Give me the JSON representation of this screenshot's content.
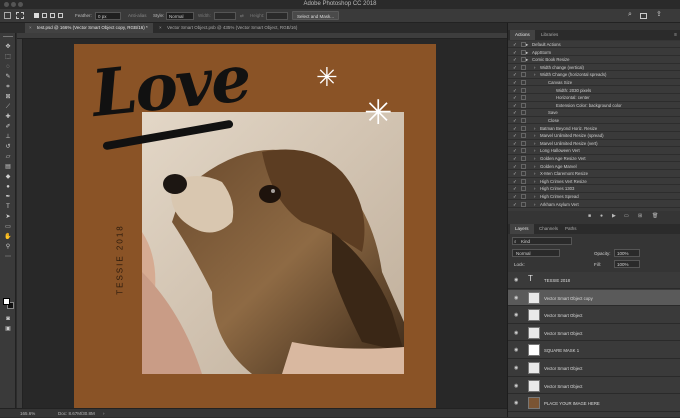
{
  "window": {
    "title": "Adobe Photoshop CC 2018"
  },
  "options_bar": {
    "feather_label": "Feather:",
    "feather_value": "0 px",
    "antialias_label": "Anti-alias",
    "style_label": "Style:",
    "style_value": "Normal",
    "width_label": "Width:",
    "height_label": "Height:",
    "select_mask_label": "Select and Mask..."
  },
  "tabs": [
    {
      "label": "test.psd @ 166% (Vector Smart Object copy, RGB/16) *"
    },
    {
      "label": "Vector Smart Object.psb @ 435% (Vector Smart Object, RGB/16)"
    }
  ],
  "artwork": {
    "love_text": "Love",
    "side_text": "TESSIE 2018"
  },
  "status": {
    "zoom": "165.6%",
    "doc": "Doc: 8.67M/30.8M"
  },
  "actions_panel": {
    "tabs": [
      "Actions",
      "Libraries"
    ],
    "rows": [
      {
        "label": "Default Actions",
        "kind": "folder",
        "indent": 0
      },
      {
        "label": "AppStorm",
        "kind": "folder",
        "indent": 0
      },
      {
        "label": "Comic Book Resize",
        "kind": "folder",
        "indent": 0
      },
      {
        "label": "Width change (vertical)",
        "kind": "action",
        "indent": 1
      },
      {
        "label": "Width Change (horizontal spreads)",
        "kind": "action",
        "indent": 1
      },
      {
        "label": "Canvas Size",
        "kind": "step",
        "indent": 2
      },
      {
        "label": "Width: 2030 pixels",
        "kind": "detail",
        "indent": 3
      },
      {
        "label": "Horizontal: center",
        "kind": "detail",
        "indent": 3
      },
      {
        "label": "Extension Color: background color",
        "kind": "detail",
        "indent": 3
      },
      {
        "label": "Save",
        "kind": "step",
        "indent": 2
      },
      {
        "label": "Close",
        "kind": "step",
        "indent": 2
      },
      {
        "label": "Batman Beyond Horiz. Resize",
        "kind": "action",
        "indent": 1
      },
      {
        "label": "Marvel Unlimited Resize (spread)",
        "kind": "action",
        "indent": 1
      },
      {
        "label": "Marvel Unlimited Resize (vert)",
        "kind": "action",
        "indent": 1
      },
      {
        "label": "Long Halloween Vert",
        "kind": "action",
        "indent": 1
      },
      {
        "label": "Golden Age Resize Vert",
        "kind": "action",
        "indent": 1
      },
      {
        "label": "Golden Age Marvel",
        "kind": "action",
        "indent": 1
      },
      {
        "label": "X-Men Claremont Resize",
        "kind": "action",
        "indent": 1
      },
      {
        "label": "High Crimes Vert Resize",
        "kind": "action",
        "indent": 1
      },
      {
        "label": "High Crimes 1303",
        "kind": "action",
        "indent": 1
      },
      {
        "label": "High Crimes Spread",
        "kind": "action",
        "indent": 1
      },
      {
        "label": "Arkham Asylum Vert",
        "kind": "action",
        "indent": 1
      }
    ]
  },
  "layers_panel": {
    "tabs": [
      "Layers",
      "Channels",
      "Paths"
    ],
    "kind_label": "Kind",
    "blend_mode": "Normal",
    "opacity_label": "Opacity:",
    "opacity_value": "100%",
    "lock_label": "Lock:",
    "fill_label": "Fill:",
    "fill_value": "100%",
    "layers": [
      {
        "name": "TESSIE 2018",
        "type": "text",
        "selected": false
      },
      {
        "name": "Vector Smart Object copy",
        "type": "smart",
        "selected": true
      },
      {
        "name": "Vector Smart Object",
        "type": "smart",
        "selected": false
      },
      {
        "name": "Vector Smart Object",
        "type": "smart",
        "selected": false
      },
      {
        "name": "SQUARE MASK 1",
        "type": "shape",
        "selected": false
      },
      {
        "name": "Vector Smart Object",
        "type": "smart",
        "selected": false
      },
      {
        "name": "Vector Smart Object",
        "type": "smart",
        "selected": false
      },
      {
        "name": "PLACE YOUR IMAGE HERE",
        "type": "image",
        "selected": false
      }
    ]
  },
  "colors": {
    "artboard": "#8a5326",
    "ui_dark": "#282828",
    "panel": "#353535"
  }
}
